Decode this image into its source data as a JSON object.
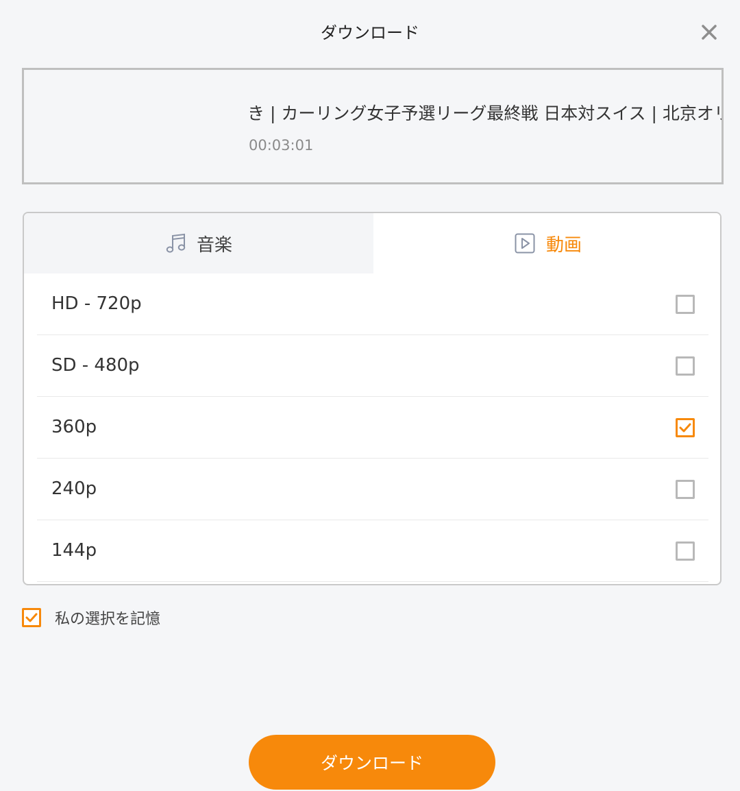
{
  "dialog": {
    "title": "ダウンロード",
    "close_icon": "close-icon"
  },
  "video": {
    "title": "き | カーリング女子予選リーグ最終戦 日本対スイス | 北京オリン",
    "duration": "00:03:01"
  },
  "tabs": [
    {
      "label": "音楽",
      "icon": "music-note-icon",
      "active": false
    },
    {
      "label": "動画",
      "icon": "video-play-icon",
      "active": true
    }
  ],
  "qualities": [
    {
      "label": "HD - 720p",
      "checked": false
    },
    {
      "label": "SD - 480p",
      "checked": false
    },
    {
      "label": "360p",
      "checked": true
    },
    {
      "label": "240p",
      "checked": false
    },
    {
      "label": "144p",
      "checked": false
    }
  ],
  "remember": {
    "label": "私の選択を記憶",
    "checked": true
  },
  "download_button": {
    "label": "ダウンロード"
  },
  "colors": {
    "accent": "#f7890b",
    "background": "#f5f6f8"
  }
}
